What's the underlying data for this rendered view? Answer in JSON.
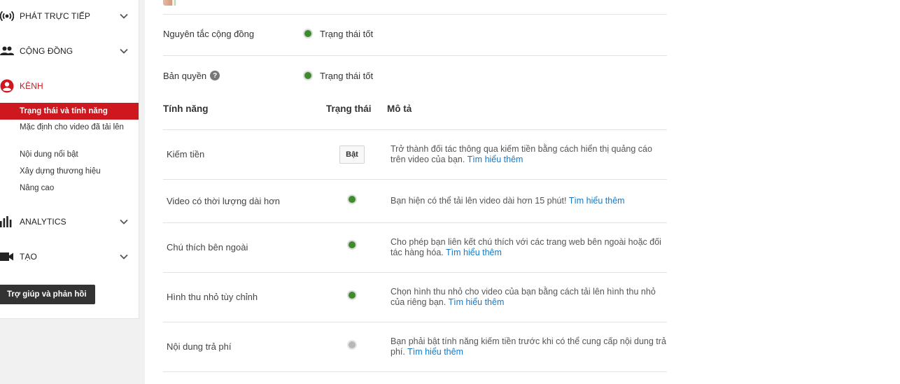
{
  "sidebar": {
    "sections": [
      {
        "label": "PHÁT TRỰC TIẾP",
        "icon": "live-broadcast-icon",
        "expandable": true
      },
      {
        "label": "CỘNG ĐỒNG",
        "icon": "people-icon",
        "expandable": true
      },
      {
        "label": "KÊNH",
        "icon": "account-circle-icon",
        "expandable": false
      },
      {
        "label": "ANALYTICS",
        "icon": "bar-chart-icon",
        "expandable": true
      },
      {
        "label": "TẠO",
        "icon": "video-camera-icon",
        "expandable": true
      }
    ],
    "channel_items": [
      {
        "label": "Trạng thái và tính năng",
        "active": true
      },
      {
        "label": "Mặc định cho video đã tải lên",
        "active": false
      },
      {
        "label": "Nội dung nổi bật",
        "active": false
      },
      {
        "label": "Xây dựng thương hiệu",
        "active": false
      },
      {
        "label": "Nâng cao",
        "active": false
      }
    ],
    "help_button": "Trợ giúp và phản hồi"
  },
  "main": {
    "status": [
      {
        "label": "Nguyên tắc cộng đồng",
        "value": "Trạng thái tốt",
        "has_help": false
      },
      {
        "label": "Bản quyền",
        "value": "Trạng thái tốt",
        "has_help": true
      }
    ],
    "table": {
      "headers": {
        "feature": "Tính năng",
        "status": "Trạng thái",
        "description": "Mô tả"
      },
      "rows": [
        {
          "name": "Kiếm tiền",
          "status": "button",
          "button_label": "Bật",
          "desc": "Trở thành đối tác thông qua kiếm tiền bằng cách hiển thị quảng cáo trên video của bạn.",
          "link": "Tìm hiểu thêm"
        },
        {
          "name": "Video có thời lượng dài hơn",
          "status": "enabled",
          "desc": "Bạn hiện có thể tải lên video dài hơn 15 phút!",
          "link": "Tìm hiểu thêm"
        },
        {
          "name": "Chú thích bên ngoài",
          "status": "enabled",
          "desc": "Cho phép bạn liên kết chú thích với các trang web bên ngoài hoặc đối tác hàng hóa.",
          "link": "Tìm hiểu thêm"
        },
        {
          "name": "Hình thu nhỏ tùy chỉnh",
          "status": "enabled",
          "desc": "Chọn hình thu nhỏ cho video của bạn bằng cách tải lên hình thu nhỏ của riêng bạn.",
          "link": "Tìm hiểu thêm"
        },
        {
          "name": "Nội dung trả phí",
          "status": "disabled",
          "desc": "Bạn phải bật tính năng kiếm tiền trước khi có thể cung cấp nội dung trả phí.",
          "link": "Tìm hiểu thêm"
        }
      ]
    },
    "colors": {
      "accent": "#cc181e",
      "link": "#167ac6",
      "status_good": "#3d8b2a",
      "status_off": "#b8b8b8"
    }
  }
}
